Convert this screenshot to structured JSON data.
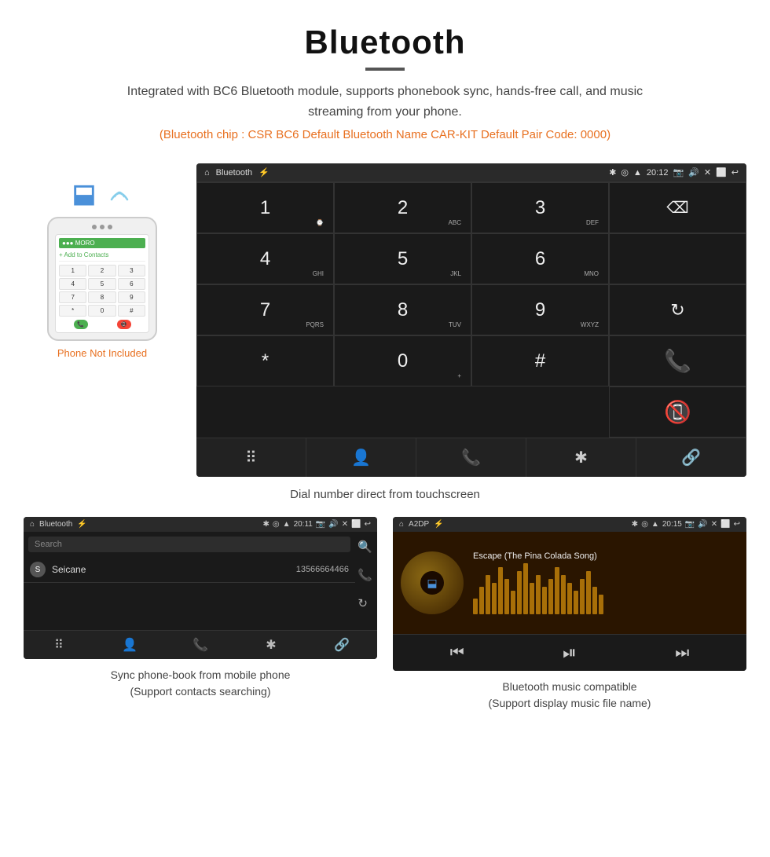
{
  "header": {
    "title": "Bluetooth",
    "description": "Integrated with BC6 Bluetooth module, supports phonebook sync, hands-free call, and music streaming from your phone.",
    "spec_line": "(Bluetooth chip : CSR BC6    Default Bluetooth Name CAR-KIT    Default Pair Code: 0000)"
  },
  "phone_mockup": {
    "not_included": "Phone Not Included",
    "keys": [
      "1",
      "2",
      "3",
      "4",
      "5",
      "6",
      "7",
      "8",
      "9",
      "*",
      "0",
      "#"
    ]
  },
  "car_dialpad": {
    "status_bar": {
      "app_name": "Bluetooth",
      "time": "20:12"
    },
    "keys": [
      {
        "main": "1",
        "sub": ""
      },
      {
        "main": "2",
        "sub": "ABC"
      },
      {
        "main": "3",
        "sub": "DEF"
      },
      {
        "main": "",
        "sub": "backspace"
      },
      {
        "main": "4",
        "sub": "GHI"
      },
      {
        "main": "5",
        "sub": "JKL"
      },
      {
        "main": "6",
        "sub": "MNO"
      },
      {
        "main": "",
        "sub": "empty"
      },
      {
        "main": "7",
        "sub": "PQRS"
      },
      {
        "main": "8",
        "sub": "TUV"
      },
      {
        "main": "9",
        "sub": "WXYZ"
      },
      {
        "main": "",
        "sub": "refresh"
      },
      {
        "main": "*",
        "sub": ""
      },
      {
        "main": "0",
        "sub": "+"
      },
      {
        "main": "#",
        "sub": ""
      },
      {
        "main": "",
        "sub": "call"
      },
      {
        "main": "",
        "sub": "hangup"
      }
    ],
    "caption": "Dial number direct from touchscreen"
  },
  "phonebook_screen": {
    "status_bar": {
      "app_name": "Bluetooth",
      "time": "20:11"
    },
    "search_placeholder": "Search",
    "contact": {
      "initial": "S",
      "name": "Seicane",
      "phone": "13566664466"
    },
    "caption_line1": "Sync phone-book from mobile phone",
    "caption_line2": "(Support contacts searching)"
  },
  "music_screen": {
    "status_bar": {
      "app_name": "A2DP",
      "time": "20:15"
    },
    "song_title": "Escape (The Pina Colada Song)",
    "visualizer_bars": [
      20,
      35,
      50,
      40,
      60,
      45,
      30,
      55,
      65,
      40,
      50,
      35,
      45,
      60,
      50,
      40,
      30,
      45,
      55,
      35,
      25
    ],
    "caption_line1": "Bluetooth music compatible",
    "caption_line2": "(Support display music file name)"
  }
}
